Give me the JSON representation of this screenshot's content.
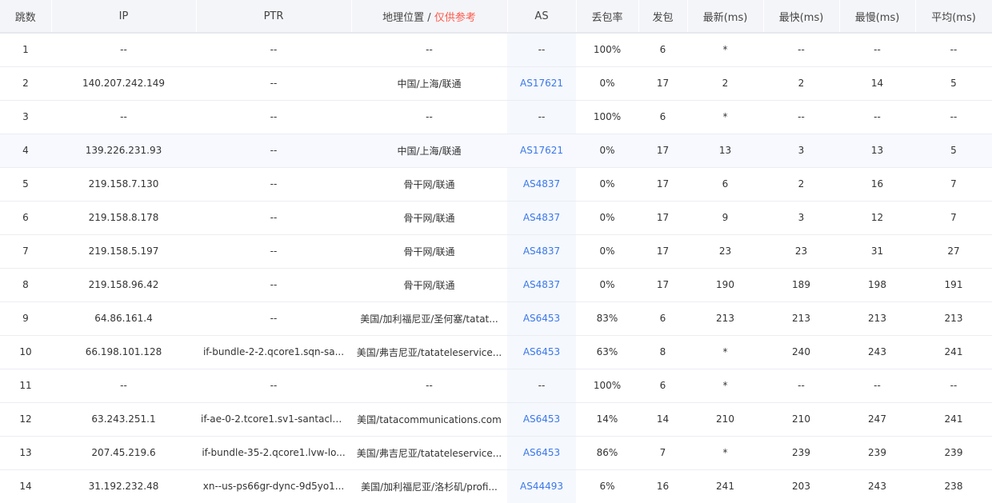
{
  "columns": {
    "hop": "跳数",
    "ip": "IP",
    "ptr": "PTR",
    "geo": "地理位置",
    "geo_sep": " / ",
    "geo_note": "仅供参考",
    "as": "AS",
    "loss": "丢包率",
    "sent": "发包",
    "last": "最新(ms)",
    "best": "最快(ms)",
    "worst": "最慢(ms)",
    "avg": "平均(ms)"
  },
  "colors": {
    "link": "#3b78e7",
    "warn": "#ff5a4c",
    "header_bg": "#f4f5f9"
  },
  "rows": [
    {
      "hop": "1",
      "ip": "--",
      "ptr": "--",
      "geo": "--",
      "as": "--",
      "loss": "100%",
      "sent": "6",
      "last": "*",
      "best": "--",
      "worst": "--",
      "avg": "--"
    },
    {
      "hop": "2",
      "ip": "140.207.242.149",
      "ptr": "--",
      "geo": "中国/上海/联通",
      "as": "AS17621",
      "loss": "0%",
      "sent": "17",
      "last": "2",
      "best": "2",
      "worst": "14",
      "avg": "5"
    },
    {
      "hop": "3",
      "ip": "--",
      "ptr": "--",
      "geo": "--",
      "as": "--",
      "loss": "100%",
      "sent": "6",
      "last": "*",
      "best": "--",
      "worst": "--",
      "avg": "--"
    },
    {
      "hop": "4",
      "ip": "139.226.231.93",
      "ptr": "--",
      "geo": "中国/上海/联通",
      "as": "AS17621",
      "loss": "0%",
      "sent": "17",
      "last": "13",
      "best": "3",
      "worst": "13",
      "avg": "5"
    },
    {
      "hop": "5",
      "ip": "219.158.7.130",
      "ptr": "--",
      "geo": "骨干网/联通",
      "as": "AS4837",
      "loss": "0%",
      "sent": "17",
      "last": "6",
      "best": "2",
      "worst": "16",
      "avg": "7"
    },
    {
      "hop": "6",
      "ip": "219.158.8.178",
      "ptr": "--",
      "geo": "骨干网/联通",
      "as": "AS4837",
      "loss": "0%",
      "sent": "17",
      "last": "9",
      "best": "3",
      "worst": "12",
      "avg": "7"
    },
    {
      "hop": "7",
      "ip": "219.158.5.197",
      "ptr": "--",
      "geo": "骨干网/联通",
      "as": "AS4837",
      "loss": "0%",
      "sent": "17",
      "last": "23",
      "best": "23",
      "worst": "31",
      "avg": "27"
    },
    {
      "hop": "8",
      "ip": "219.158.96.42",
      "ptr": "--",
      "geo": "骨干网/联通",
      "as": "AS4837",
      "loss": "0%",
      "sent": "17",
      "last": "190",
      "best": "189",
      "worst": "198",
      "avg": "191"
    },
    {
      "hop": "9",
      "ip": "64.86.161.4",
      "ptr": "--",
      "geo": "美国/加利福尼亚/圣何塞/tatat...",
      "as": "AS6453",
      "loss": "83%",
      "sent": "6",
      "last": "213",
      "best": "213",
      "worst": "213",
      "avg": "213"
    },
    {
      "hop": "10",
      "ip": "66.198.101.128",
      "ptr": "if-bundle-2-2.qcore1.sqn-sa...",
      "geo": "美国/弗吉尼亚/tatateleservice...",
      "as": "AS6453",
      "loss": "63%",
      "sent": "8",
      "last": "*",
      "best": "240",
      "worst": "243",
      "avg": "241"
    },
    {
      "hop": "11",
      "ip": "--",
      "ptr": "--",
      "geo": "--",
      "as": "--",
      "loss": "100%",
      "sent": "6",
      "last": "*",
      "best": "--",
      "worst": "--",
      "avg": "--"
    },
    {
      "hop": "12",
      "ip": "63.243.251.1",
      "ptr": "if-ae-0-2.tcore1.sv1-santacla...",
      "geo": "美国/tatacommunications.com",
      "as": "AS6453",
      "loss": "14%",
      "sent": "14",
      "last": "210",
      "best": "210",
      "worst": "247",
      "avg": "241"
    },
    {
      "hop": "13",
      "ip": "207.45.219.6",
      "ptr": "if-bundle-35-2.qcore1.lvw-lo...",
      "geo": "美国/弗吉尼亚/tatateleservice...",
      "as": "AS6453",
      "loss": "86%",
      "sent": "7",
      "last": "*",
      "best": "239",
      "worst": "239",
      "avg": "239"
    },
    {
      "hop": "14",
      "ip": "31.192.232.48",
      "ptr": "xn--us-ps66gr-dync-9d5yo1...",
      "geo": "美国/加利福尼亚/洛杉矶/profi...",
      "as": "AS44493",
      "loss": "6%",
      "sent": "16",
      "last": "241",
      "best": "203",
      "worst": "243",
      "avg": "238"
    }
  ]
}
